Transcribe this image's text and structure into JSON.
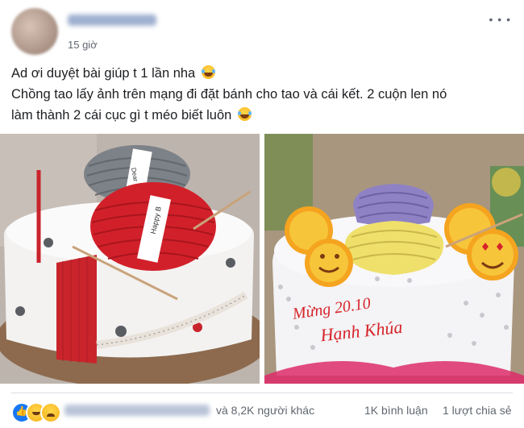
{
  "post": {
    "timestamp": "15 giờ",
    "more_icon": "more-horizontal-icon",
    "text_line1": "Ad ơi duyệt bài giúp t 1 lần nha",
    "text_line2": "Chồng tao lấy ảnh trên mạng đi đặt bánh cho tao và cái kết. 2 cuộn len nó",
    "text_line3": "làm thành 2 cái cục gì t méo biết luôn",
    "emoji_icon": "rolling-on-floor-laughing-icon"
  },
  "photos": {
    "left": {
      "ribbon_text_top": "Dear",
      "ribbon_text": "Happy B",
      "description_icon": "knitting-cake-reference-photo"
    },
    "right": {
      "cake_text_line1": "Mừng 20.10",
      "cake_text_line2": "Hạnh Khúa",
      "description_icon": "knitting-cake-result-photo"
    }
  },
  "footer": {
    "reactions": [
      "like-icon",
      "haha-icon",
      "sad-icon"
    ],
    "others": "và 8,2K người khác",
    "comments": "1K bình luận",
    "shares": "1 lượt chia sẻ"
  },
  "colors": {
    "text": "#1c1e21",
    "meta": "#616770",
    "like_blue": "#1877f2",
    "yarn_red": "#d2202a",
    "yarn_gray": "#7d8288",
    "fondant_white": "#f3f2f1",
    "lilac": "#8f82c4",
    "yellow_cream": "#efe06b",
    "emoji_orange": "#f5a41f"
  }
}
